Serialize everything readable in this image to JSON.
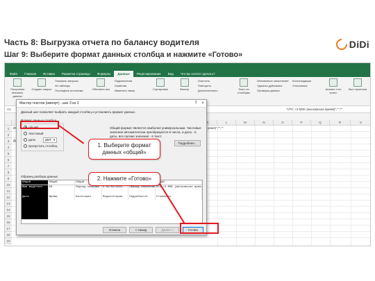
{
  "slide": {
    "title": "Часть 8: Выгрузка отчета по  балансу водителя",
    "subtitle": "Шаг 9: Выберите формат данных столбца и нажмите «Готово»",
    "logo_text": "DiDi",
    "accent_color": "#f07a18"
  },
  "excel": {
    "tabs": [
      "Файл",
      "Главная",
      "Вставка",
      "Разметка страницы",
      "Формулы",
      "Данные",
      "Рецензирование",
      "Вид",
      "Что вы хотите сделать?"
    ],
    "active_tab": "Данные",
    "ribbon_items": [
      "Получение внешних данных",
      "Создать запрос",
      "Обновить все",
      "Сортировка",
      "Фильтр",
      "Текст по столбцам",
      "Анализ «что если»",
      "Лист прогноза"
    ],
    "ribbon_list_1": [
      "Показать запросы",
      "Из таблицы",
      "Последние источники"
    ],
    "ribbon_list_2": [
      "Подключения",
      "Свойства",
      "Изменить связи"
    ],
    "ribbon_list_3": [
      "Очистить",
      "Повторить",
      "Дополнительно"
    ],
    "ribbon_list_4": [
      "Мгновенное заполнение",
      "Удалить дубликаты",
      "Проверка данных"
    ],
    "ribbon_list_5": [
      "Консолидация",
      "Отношения",
      "Управление моделью данных"
    ],
    "group_captions": [
      "Скачать & преобразовать",
      "Подключения",
      "Сортировка и фильтр",
      "Работа с данными",
      "Прогноз"
    ],
    "name_box": "A1",
    "formula_text": "\"UTC +3 MSK (московское время)\",\"\",\"\"",
    "columns": [
      "A",
      "B",
      "C",
      "D",
      "E",
      "F",
      "G",
      "H",
      "I",
      "J",
      "K",
      "L",
      "M",
      "N",
      "O",
      "P",
      "Q",
      "R",
      "S"
    ],
    "rows": [
      "1",
      "2",
      "3",
      "4",
      "5",
      "6",
      "7",
      "8",
      "9",
      "10",
      "11",
      "12",
      "13",
      "14",
      "15",
      "16",
      "17",
      "18",
      "19"
    ],
    "cell_a1": "Имя",
    "cell_a3": "Дат",
    "cell_right_text": "ремя)\",\"\",\"\""
  },
  "dialog": {
    "title": "Мастер текстов (импорт) - шаг 3 из 3",
    "help": "?",
    "close": "×",
    "intro": "Данный шаг позволяет выбрать каждый столбец и установить формат данных.",
    "fieldset_label": "Формат данных столбца",
    "options": [
      "общий",
      "текстовый",
      "дата:",
      "пропустить столбец"
    ],
    "selected_option": "общий",
    "date_format": "ДМГ",
    "description": "Общий формат является наиболее универсальным. Числовые значения автоматически преобразуются в числа, а даты - в даты, все прочие значения - в текст.",
    "more_button": "Подробнее...",
    "preview_label": "Образец разбора данных",
    "preview_header": [
      "Общий",
      "Общий",
      "Общий",
      "Общий",
      "Общий",
      "Общий"
    ],
    "preview_rows": [
      [
        "Имя водителя",
        "ЕИ",
        "Период начиная",
        "с 02/02/2021",
        "Период заканчивая 02/02/2021",
        "UTC +3 MSK (московское время)"
      ],
      [
        "",
        "",
        "",
        "",
        "",
        ""
      ],
      [
        "Дата",
        "Время",
        "Категория",
        "Подкатегория",
        "Подробности",
        "Стоимость"
      ]
    ],
    "buttons": {
      "cancel": "Отмена",
      "back": "< Назад",
      "next": "Далее >",
      "finish": "Готово"
    }
  },
  "callouts": {
    "step1": "1. Выберите формат данных «общий»",
    "step2": "2. Нажмите «Готово»"
  }
}
